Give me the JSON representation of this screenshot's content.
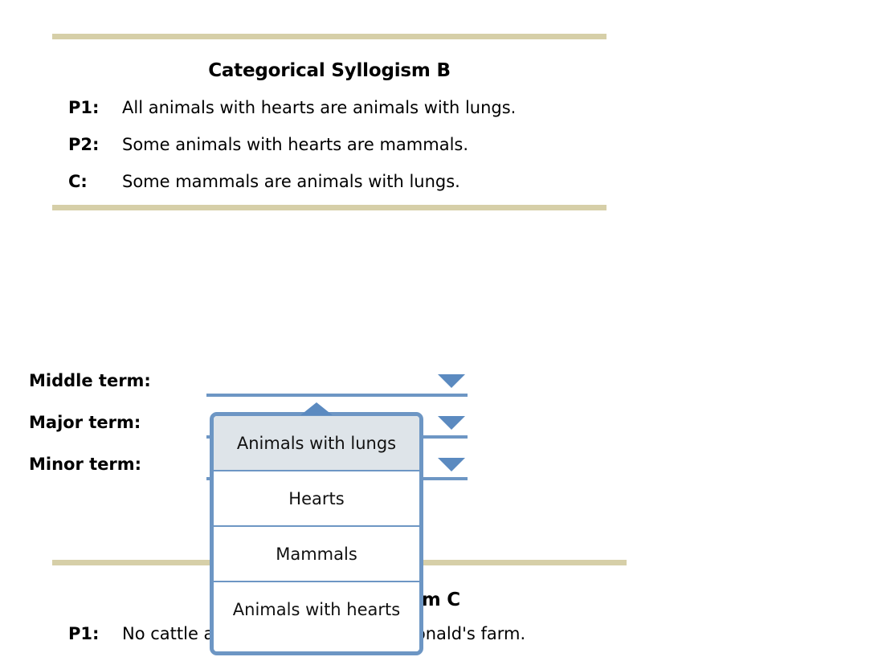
{
  "theme": {
    "rule_color": "#d6cfa8",
    "accent_blue": "#6d96c4",
    "caret_blue": "#5b8ac0",
    "selected_bg": "#dee4e9",
    "text_color": "#000000"
  },
  "syllogism_b": {
    "title": "Categorical Syllogism B",
    "rows": [
      {
        "label": "P1:",
        "text": "All animals with hearts are animals with lungs."
      },
      {
        "label": "P2:",
        "text": "Some animals with hearts are mammals."
      },
      {
        "label": "C:",
        "text": "Some mammals are animals with lungs."
      }
    ]
  },
  "terms": {
    "middle": {
      "label": "Middle term:",
      "value": ""
    },
    "major": {
      "label": "Major term:",
      "value": ""
    },
    "minor": {
      "label": "Minor term:",
      "value": ""
    }
  },
  "dropdown": {
    "open_for": "Major term:",
    "selected": "Animals with lungs",
    "options": [
      "Animals with lungs",
      "Hearts",
      "Mammals",
      "Animals with hearts"
    ]
  },
  "syllogism_c": {
    "title": "Categorical Syllogism C",
    "rows": [
      {
        "label": "P1:",
        "text": "No cattle are animals on Old MacDonald's farm."
      }
    ]
  },
  "icons": {
    "dropdown_arrow": "chevron-down-icon",
    "dropdown_tab": "chevron-up-icon"
  }
}
